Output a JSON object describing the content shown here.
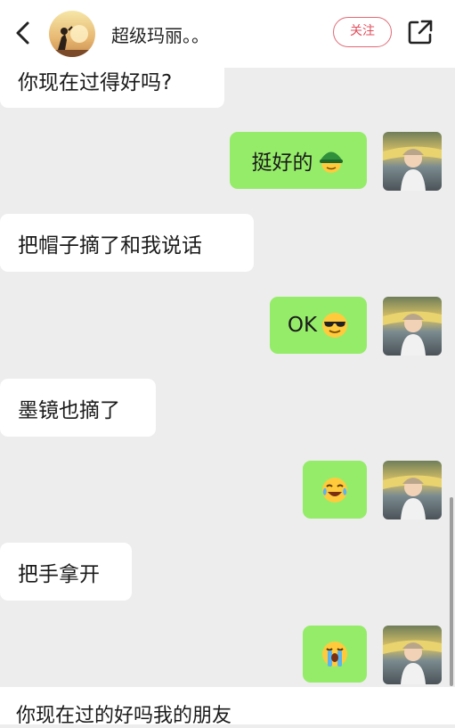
{
  "header": {
    "title": "超级玛丽。。",
    "follow_label": "关注"
  },
  "messages": [
    {
      "side": "left",
      "text": "你现在过得好吗?"
    },
    {
      "side": "right",
      "text": "挺好的",
      "emoji": "green-helmet-emoji"
    },
    {
      "side": "left",
      "text": "把帽子摘了和我说话"
    },
    {
      "side": "right",
      "text": "OK",
      "emoji": "sunglasses-emoji"
    },
    {
      "side": "left",
      "text": "墨镜也摘了"
    },
    {
      "side": "right",
      "text": "",
      "emoji": "tears-of-joy-emoji"
    },
    {
      "side": "left",
      "text": "把手拿开"
    },
    {
      "side": "right",
      "text": "",
      "emoji": "crying-emoji"
    }
  ],
  "input": {
    "text": "你现在过的好吗我的朋友"
  },
  "colors": {
    "chat_bg": "#ededed",
    "my_bubble": "#95ec69",
    "their_bubble": "#ffffff",
    "follow_accent": "#e0505d"
  }
}
